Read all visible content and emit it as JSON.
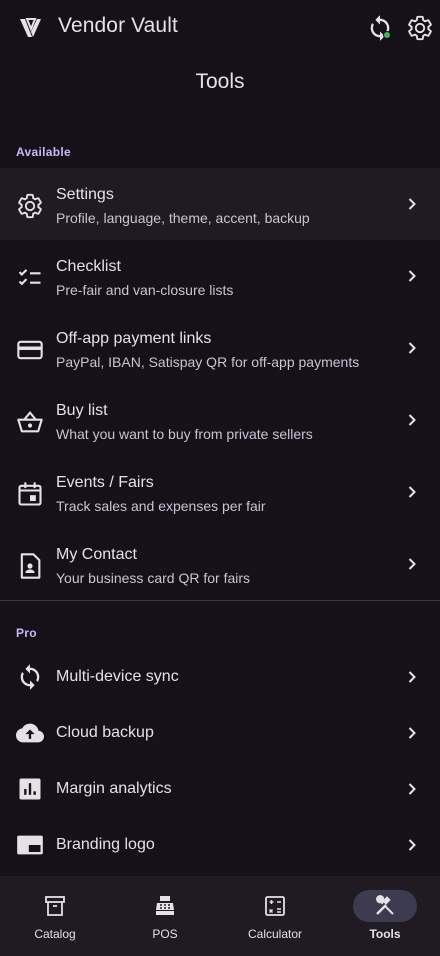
{
  "app": {
    "title": "Vendor Vault"
  },
  "page": {
    "title": "Tools"
  },
  "sections": {
    "available": "Available",
    "pro": "Pro"
  },
  "available_items": [
    {
      "title": "Settings",
      "subtitle": "Profile, language, theme, accent, backup",
      "icon": "gear-icon"
    },
    {
      "title": "Checklist",
      "subtitle": "Pre-fair and van-closure lists",
      "icon": "checklist-icon"
    },
    {
      "title": "Off-app payment links",
      "subtitle": "PayPal, IBAN, Satispay QR for off-app payments",
      "icon": "credit-card-icon"
    },
    {
      "title": "Buy list",
      "subtitle": "What you want to buy from private sellers",
      "icon": "basket-icon"
    },
    {
      "title": "Events / Fairs",
      "subtitle": "Track sales and expenses per fair",
      "icon": "calendar-icon"
    },
    {
      "title": "My Contact",
      "subtitle": "Your business card QR for fairs",
      "icon": "contact-card-icon"
    }
  ],
  "pro_items": [
    {
      "title": "Multi-device sync",
      "icon": "sync-icon"
    },
    {
      "title": "Cloud backup",
      "icon": "cloud-upload-icon"
    },
    {
      "title": "Margin analytics",
      "icon": "analytics-icon"
    },
    {
      "title": "Branding logo",
      "icon": "branding-icon"
    }
  ],
  "nav": [
    {
      "label": "Catalog",
      "icon": "archive-icon"
    },
    {
      "label": "POS",
      "icon": "cash-register-icon"
    },
    {
      "label": "Calculator",
      "icon": "calculator-icon"
    },
    {
      "label": "Tools",
      "icon": "tools-icon"
    }
  ],
  "colors": {
    "background": "#141218",
    "accent": "#c9b8f5",
    "sync_status": "#4caf50",
    "active_pill": "#3d3b4f"
  }
}
